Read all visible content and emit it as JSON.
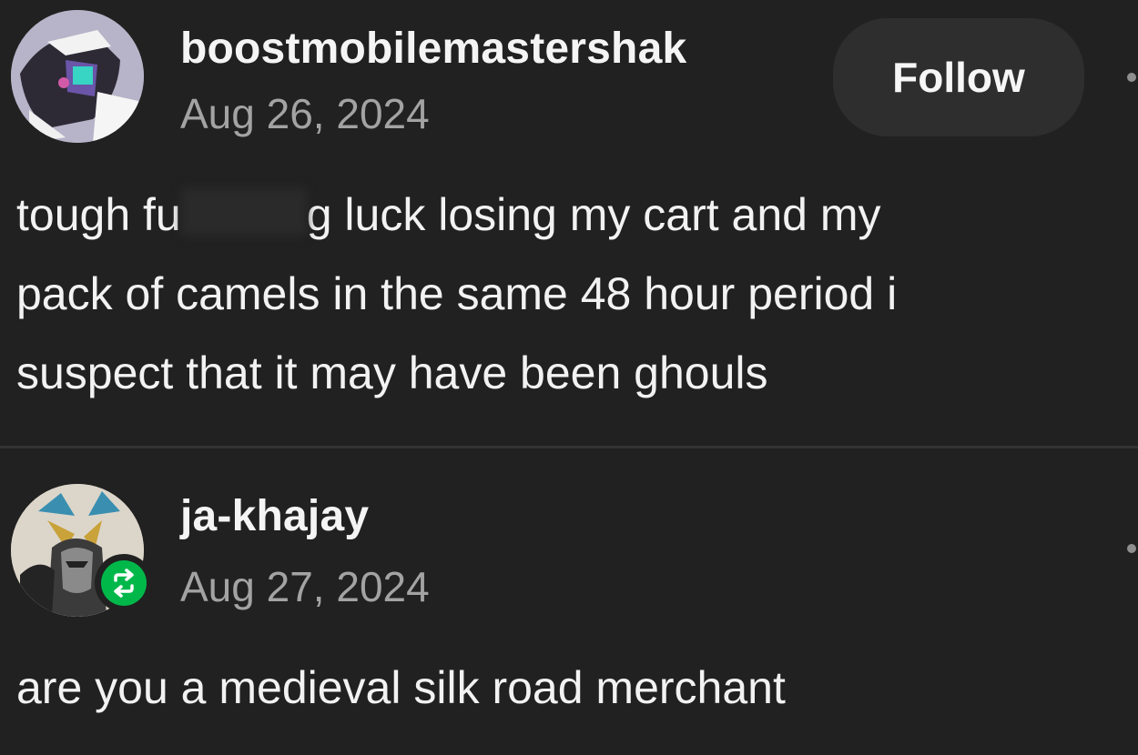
{
  "posts": [
    {
      "username": "boostmobilemastershak",
      "date": "Aug 26, 2024",
      "follow_label": "Follow",
      "avatar_icon": "avatar-robot-icon",
      "body": {
        "line1_before": "tough fu",
        "line1_after": "g luck losing my cart and my",
        "line2": "pack of camels in the same 48 hour period i",
        "line3": "suspect that it may have been ghouls"
      }
    },
    {
      "username": "ja-khajay",
      "date": "Aug 27, 2024",
      "avatar_icon": "avatar-illustration-icon",
      "badge_icon": "reblog-icon",
      "badge_color": "#00b84a",
      "body": {
        "line1": "are you a medieval silk road merchant"
      }
    }
  ],
  "colors": {
    "background": "#212121",
    "text": "#f2f2f2",
    "muted": "#a3a3a3",
    "follow_bg": "#2e2e2e"
  }
}
